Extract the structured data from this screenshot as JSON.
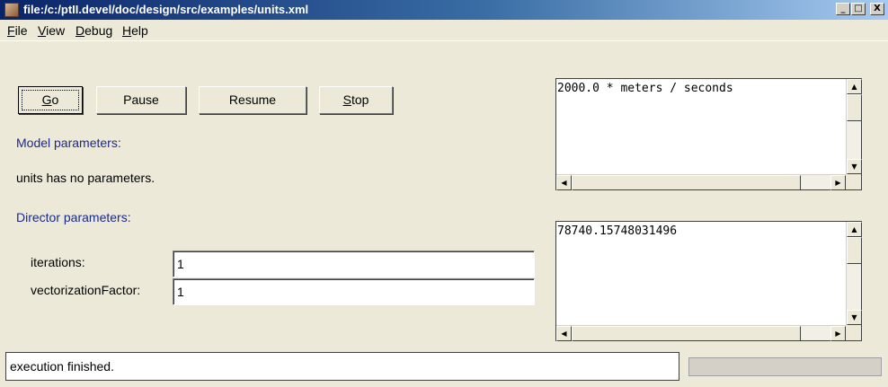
{
  "window": {
    "title": "file:/c:/ptII.devel/doc/design/src/examples/units.xml",
    "minimize": "_",
    "maximize": "□",
    "close": "X"
  },
  "menu": {
    "file": {
      "first": "F",
      "rest": "ile"
    },
    "view": {
      "first": "V",
      "rest": "iew"
    },
    "debug": {
      "first": "D",
      "rest": "ebug"
    },
    "help": {
      "first": "H",
      "rest": "elp"
    }
  },
  "toolbar": {
    "go": {
      "first": "G",
      "rest": "o"
    },
    "pause_label": "Pause",
    "resume_label": "Resume",
    "stop": {
      "first": "S",
      "rest": "top"
    }
  },
  "model": {
    "heading": "Model parameters:",
    "no_params_text": "units has no parameters."
  },
  "director": {
    "heading": "Director parameters:",
    "params": [
      {
        "label": "iterations:",
        "value": "1"
      },
      {
        "label": "vectorizationFactor:",
        "value": "1"
      }
    ]
  },
  "displays": [
    {
      "text": "2000.0 * meters / seconds"
    },
    {
      "text": "78740.15748031496"
    }
  ],
  "scroll_icons": {
    "up": "▲",
    "down": "▼",
    "left": "◀",
    "right": "▶"
  },
  "status": {
    "message": "execution finished.",
    "progress": 0
  }
}
